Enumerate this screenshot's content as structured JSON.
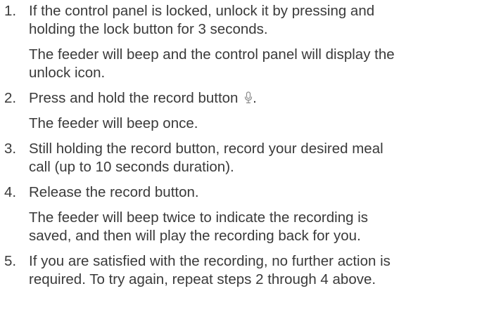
{
  "steps": [
    {
      "number": "1.",
      "lines": [
        "If the control panel is locked, unlock it by pressing and",
        "holding the lock button for 3 seconds."
      ],
      "result": [
        "The feeder will beep and the control panel will display the",
        "unlock icon."
      ]
    },
    {
      "number": "2.",
      "text": "Press and hold the record button",
      "icon": "microphone-icon",
      "suffix": ".",
      "result": [
        "The feeder will beep once."
      ]
    },
    {
      "number": "3.",
      "lines": [
        "Still holding the record button, record your desired meal",
        "call (up to 10 seconds duration)."
      ]
    },
    {
      "number": "4.",
      "lines": [
        "Release the record button."
      ],
      "result": [
        "The feeder will beep twice to indicate the recording is",
        "saved, and then will play the recording back for you."
      ]
    },
    {
      "number": "5.",
      "lines": [
        "If you are satisfied with the recording, no further action is",
        "required. To try again, repeat steps 2 through 4 above."
      ]
    }
  ]
}
